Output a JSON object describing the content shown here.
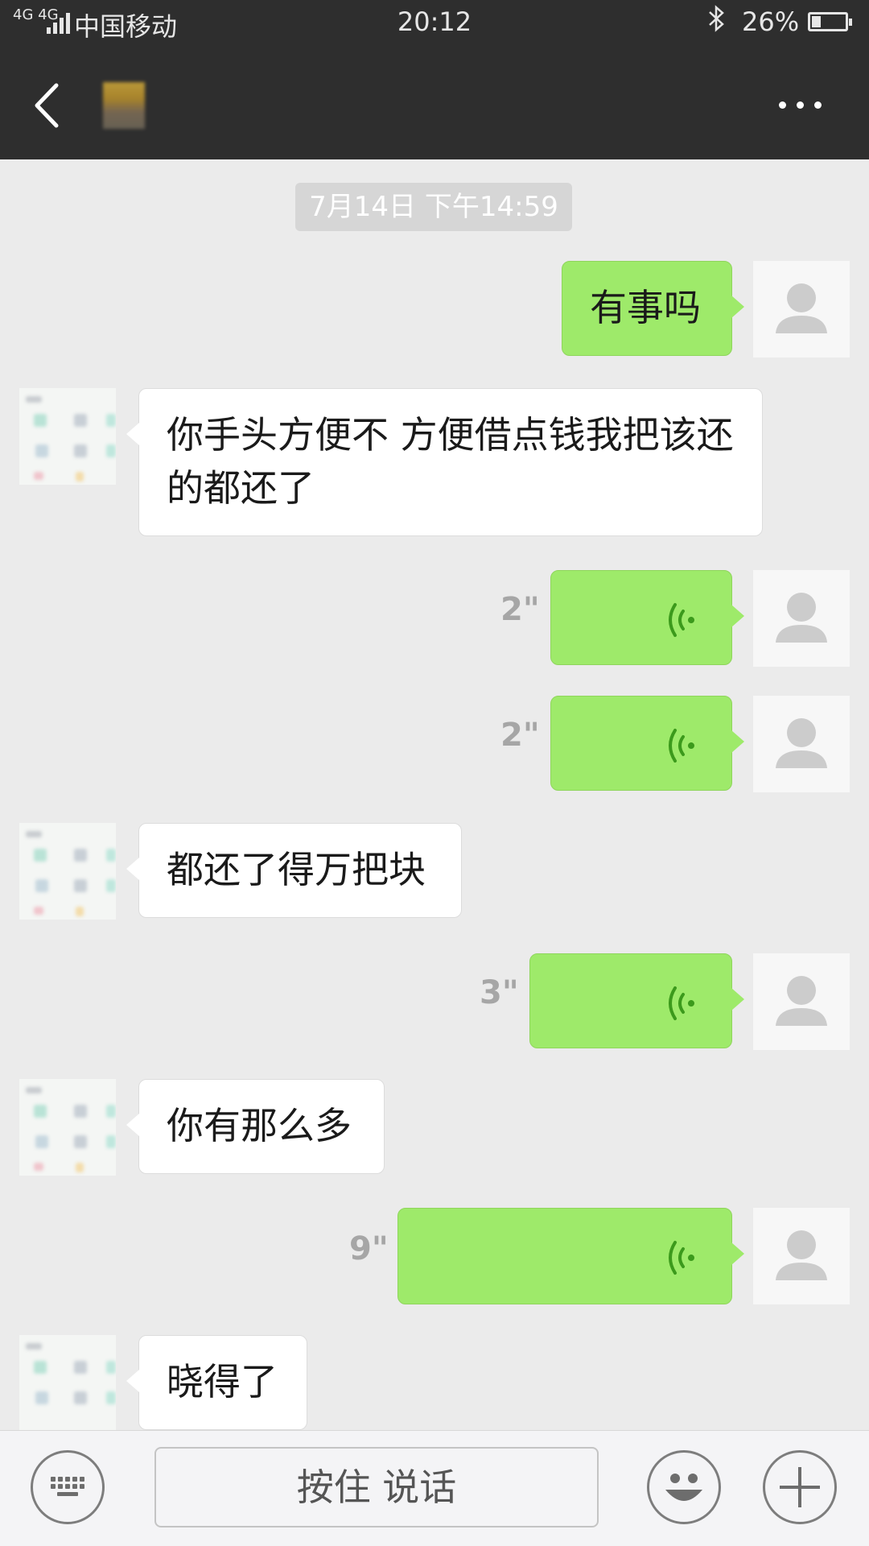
{
  "status_bar": {
    "network": "4G 4G",
    "carrier": "中国移动",
    "time": "20:12",
    "battery_percent": "26%",
    "battery_level": 0.26
  },
  "header": {
    "back_icon": "chevron-left-icon",
    "more_icon": "more-dots-icon"
  },
  "chat": {
    "timestamp": "7月14日 下午14:59",
    "messages": [
      {
        "from": "me",
        "type": "text",
        "text": "有事吗"
      },
      {
        "from": "them",
        "type": "text",
        "text": "你手头方便不   方便借点钱我把该还的都还了"
      },
      {
        "from": "me",
        "type": "voice",
        "duration": "2\""
      },
      {
        "from": "me",
        "type": "voice",
        "duration": "2\""
      },
      {
        "from": "them",
        "type": "text",
        "text": "都还了得万把块"
      },
      {
        "from": "me",
        "type": "voice",
        "duration": "3\""
      },
      {
        "from": "them",
        "type": "text",
        "text": "你有那么多"
      },
      {
        "from": "me",
        "type": "voice",
        "duration": "9\""
      },
      {
        "from": "them",
        "type": "text",
        "text": "晓得了"
      }
    ]
  },
  "input_bar": {
    "keyboard_icon": "keyboard-icon",
    "hold_to_talk_label": "按住 说话",
    "emoji_icon": "emoji-icon",
    "plus_icon": "plus-icon"
  },
  "colors": {
    "header_bg": "#2e2e2e",
    "chat_bg": "#ebebeb",
    "my_bubble": "#9eea6a",
    "their_bubble": "#ffffff",
    "voice_wave": "#3c9a1c"
  }
}
